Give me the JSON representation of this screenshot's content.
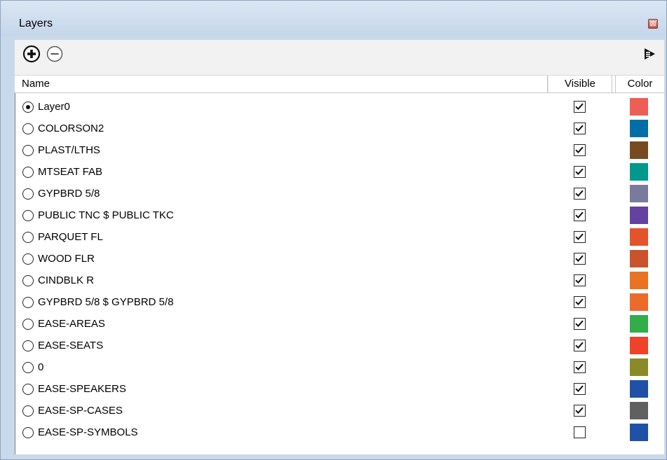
{
  "window": {
    "title": "Layers",
    "close_glyph": "⊠"
  },
  "toolbar": {
    "add_icon": "plus-circle-icon",
    "remove_icon": "minus-circle-icon",
    "details_icon": "details-arrow-icon"
  },
  "table": {
    "headers": {
      "name": "Name",
      "visible": "Visible",
      "color": "Color"
    },
    "rows": [
      {
        "name": "Layer0",
        "active": true,
        "visible": true,
        "color": "#ef5e55"
      },
      {
        "name": "COLORSON2",
        "active": false,
        "visible": true,
        "color": "#006fa6"
      },
      {
        "name": "PLAST/LTHS",
        "active": false,
        "visible": true,
        "color": "#764b1f"
      },
      {
        "name": "MTSEAT FAB",
        "active": false,
        "visible": true,
        "color": "#00998c"
      },
      {
        "name": "GYPBRD 5/8",
        "active": false,
        "visible": true,
        "color": "#7a7b9c"
      },
      {
        "name": "PUBLIC TNC $ PUBLIC TKC",
        "active": false,
        "visible": true,
        "color": "#6541a0"
      },
      {
        "name": "PARQUET FL",
        "active": false,
        "visible": true,
        "color": "#e5532b"
      },
      {
        "name": "WOOD FLR",
        "active": false,
        "visible": true,
        "color": "#c9532c"
      },
      {
        "name": "CINDBLK R",
        "active": false,
        "visible": true,
        "color": "#ea7223"
      },
      {
        "name": "GYPBRD 5/8 $ GYPBRD 5/8",
        "active": false,
        "visible": true,
        "color": "#ec6a2a"
      },
      {
        "name": "EASE-AREAS",
        "active": false,
        "visible": true,
        "color": "#31ad4a"
      },
      {
        "name": "EASE-SEATS",
        "active": false,
        "visible": true,
        "color": "#ee4229"
      },
      {
        "name": "0",
        "active": false,
        "visible": true,
        "color": "#8a8a29"
      },
      {
        "name": "EASE-SPEAKERS",
        "active": false,
        "visible": true,
        "color": "#1f52a6"
      },
      {
        "name": "EASE-SP-CASES",
        "active": false,
        "visible": true,
        "color": "#606060"
      },
      {
        "name": "EASE-SP-SYMBOLS",
        "active": false,
        "visible": false,
        "color": "#1f52a6"
      }
    ]
  }
}
